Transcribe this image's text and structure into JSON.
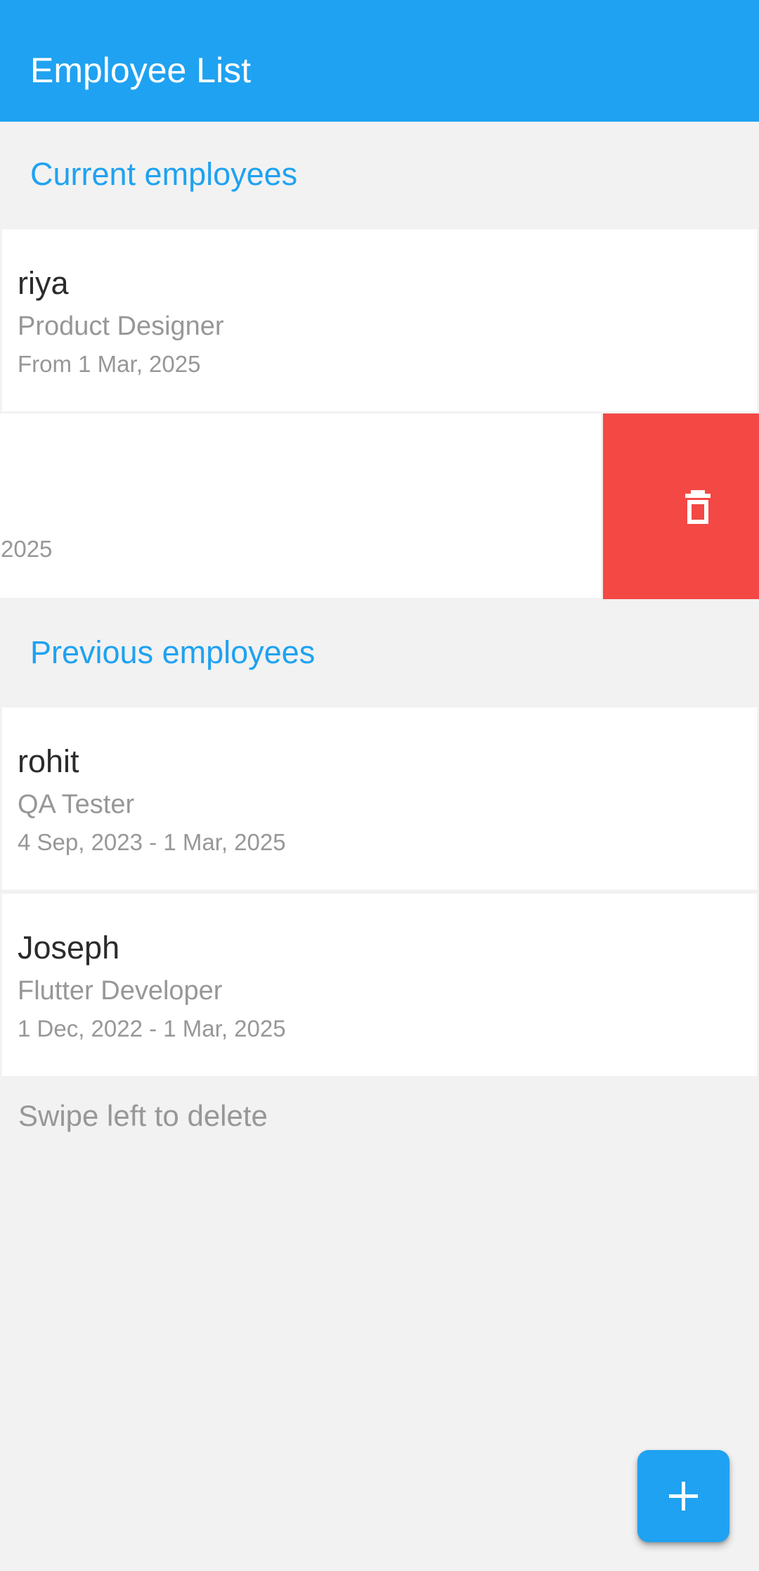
{
  "app_bar": {
    "title": "Employee List",
    "color": "#1fa2f1"
  },
  "sections": {
    "current": {
      "title": "Current employees",
      "employees": [
        {
          "name": "riya",
          "role": "Product Designer",
          "dates": "From 1 Mar, 2025"
        },
        {
          "name": "",
          "role": "",
          "dates": "2025"
        }
      ]
    },
    "previous": {
      "title": "Previous employees",
      "employees": [
        {
          "name": "rohit",
          "role": "QA Tester",
          "dates": "4 Sep, 2023 - 1 Mar, 2025"
        },
        {
          "name": "Joseph",
          "role": "Flutter Developer",
          "dates": "1 Dec, 2022 - 1 Mar, 2025"
        }
      ]
    }
  },
  "swipe_action": {
    "icon": "trash-icon",
    "color": "#f44845"
  },
  "hint": "Swipe left to delete",
  "fab": {
    "icon": "plus-icon"
  }
}
